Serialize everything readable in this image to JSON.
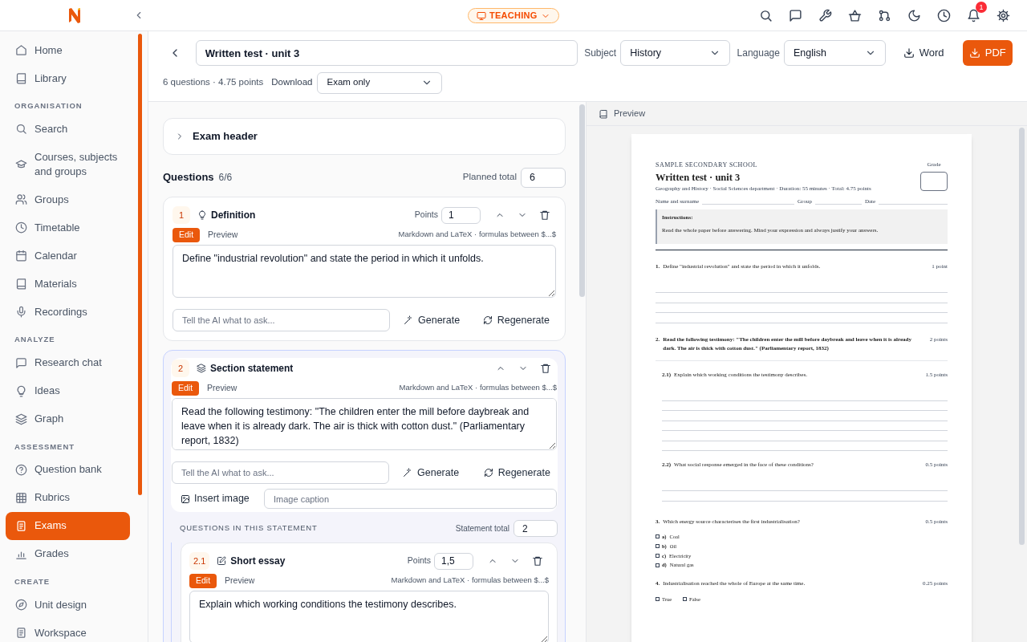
{
  "topbar": {
    "mode": "TEACHING",
    "notifications": "1"
  },
  "sidebar": {
    "sections": [
      {
        "items": [
          {
            "label": "Home",
            "selected": false
          },
          {
            "label": "Library",
            "selected": false
          }
        ]
      },
      {
        "heading": "ORGANISATION",
        "items": [
          {
            "label": "Search",
            "selected": false
          },
          {
            "label": "Courses, subjects and groups",
            "selected": false
          },
          {
            "label": "Groups",
            "selected": false
          },
          {
            "label": "Timetable",
            "selected": false
          },
          {
            "label": "Calendar",
            "selected": false
          },
          {
            "label": "Materials",
            "selected": false
          },
          {
            "label": "Recordings",
            "selected": false
          }
        ]
      },
      {
        "heading": "ANALYZE",
        "items": [
          {
            "label": "Research chat",
            "selected": false
          },
          {
            "label": "Ideas",
            "selected": false
          },
          {
            "label": "Graph",
            "selected": false
          }
        ]
      },
      {
        "heading": "ASSESSMENT",
        "items": [
          {
            "label": "Question bank",
            "selected": false
          },
          {
            "label": "Rubrics",
            "selected": false
          },
          {
            "label": "Exams",
            "selected": true
          },
          {
            "label": "Grades",
            "selected": false
          }
        ]
      },
      {
        "heading": "CREATE",
        "items": [
          {
            "label": "Unit design",
            "selected": false
          },
          {
            "label": "Workspace",
            "selected": false
          }
        ]
      }
    ]
  },
  "header": {
    "title": "Written test · unit 3",
    "subject_label": "Subject",
    "subject": "History",
    "language_label": "Language",
    "language": "English",
    "word_button": "Word",
    "pdf_button": "PDF",
    "summary": "6 questions · 4.75 points",
    "download_label": "Download",
    "download": "Exam only"
  },
  "editor": {
    "exam_header": {
      "label": "Exam header",
      "expanded": false
    },
    "questions_label": "Questions",
    "questions_count": "6/6",
    "planned_total_label": "Planned total",
    "planned_total": "6",
    "questions": [
      {
        "kind": "question",
        "number": "1",
        "type": "Definition",
        "points_label": "Points",
        "points": "1",
        "tabs": [
          {
            "label": "Edit",
            "selected": true
          },
          {
            "label": "Preview",
            "selected": false
          }
        ],
        "hint": "Markdown and LaTeX · formulas between $...$",
        "text": "Define \"industrial revolution\" and state the period in which it unfolds.",
        "ai_placeholder": "Tell the AI what to ask...",
        "generate": "Generate",
        "regenerate": "Regenerate"
      },
      {
        "kind": "section",
        "number": "2",
        "type": "Section statement",
        "tabs": [
          {
            "label": "Edit",
            "selected": true
          },
          {
            "label": "Preview",
            "selected": false
          }
        ],
        "hint": "Markdown and LaTeX · formulas between $...$",
        "text": "Read the following testimony: \"The children enter the mill before daybreak and leave when it is already dark. The air is thick with cotton dust.\" (Parliamentary report, 1832)",
        "ai_placeholder": "Tell the AI what to ask...",
        "generate": "Generate",
        "regenerate": "Regenerate",
        "insert_image": "Insert image",
        "caption_placeholder": "Image caption",
        "subheading": "QUESTIONS IN THIS STATEMENT",
        "statement_total_label": "Statement total",
        "statement_total": "2",
        "children": [
          {
            "kind": "question",
            "number": "2.1",
            "type": "Short essay",
            "points_label": "Points",
            "points": "1,5",
            "tabs": [
              {
                "label": "Edit",
                "selected": true
              },
              {
                "label": "Preview",
                "selected": false
              }
            ],
            "hint": "Markdown and LaTeX · formulas between $...$",
            "text": "Explain which working conditions the testimony describes."
          }
        ]
      }
    ]
  },
  "preview": {
    "label": "Preview",
    "school": "SAMPLE SECONDARY SCHOOL",
    "title": "Written test · unit 3",
    "meta": "Geography and History · Social Sciences department · Duration: 55 minutes · Total: 4.75 points",
    "grade_label": "Grade",
    "fields": [
      "Name and surname",
      "Group",
      "Date"
    ],
    "instructions_title": "Instructions:",
    "instructions": "Read the whole paper before answering. Mind your expression and always justify your answers.",
    "items": [
      {
        "kind": "open",
        "number": "1.",
        "text": "Define \"industrial revolution\" and state the period in which it unfolds.",
        "points": "1 point"
      },
      {
        "kind": "statement",
        "number": "2.",
        "text": "Read the following testimony: \"The children enter the mill before daybreak and leave when it is already dark. The air is thick with cotton dust.\" (Parliamentary report, 1832)",
        "points": "2 points",
        "parts": [
          {
            "kind": "long",
            "number": "2.1)",
            "text": "Explain which working conditions the testimony describes.",
            "points": "1.5 points"
          },
          {
            "kind": "short",
            "number": "2.2)",
            "text": "What social response emerged in the face of these conditions?",
            "points": "0.5 points"
          }
        ]
      },
      {
        "kind": "choice",
        "number": "3.",
        "text": "Which energy source characterises the first industrialisation?",
        "points": "0.5 points",
        "options": [
          {
            "letter": "a)",
            "text": "Coal",
            "checked": false
          },
          {
            "letter": "b)",
            "text": "Oil",
            "checked": false
          },
          {
            "letter": "c)",
            "text": "Electricity",
            "checked": false
          },
          {
            "letter": "d)",
            "text": "Natural gas",
            "checked": false
          }
        ]
      },
      {
        "kind": "truefalse",
        "number": "4.",
        "text": "Industrialisation reached the whole of Europe at the same time.",
        "points": "0.25 points",
        "options": [
          {
            "text": "True",
            "checked": false
          },
          {
            "text": "False",
            "checked": false
          }
        ]
      }
    ]
  }
}
